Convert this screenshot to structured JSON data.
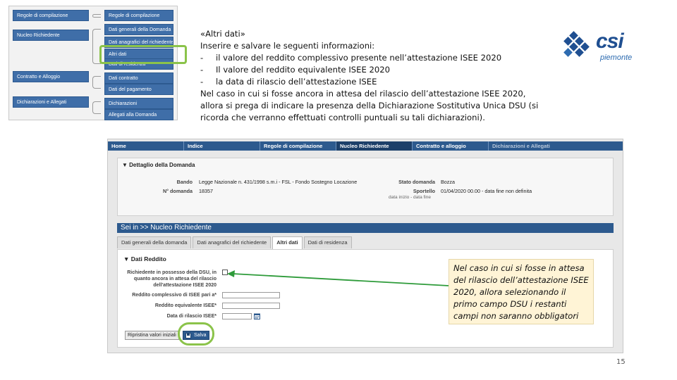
{
  "thumbnail": {
    "left_nodes": [
      "Regole di compilazione",
      "Nucleo Richiedente",
      "Contratto e Alloggio",
      "Dichiarazioni e Allegati"
    ],
    "right_nodes": [
      "Regole di compilazione",
      "Dati generali della Domanda",
      "Dati anagrafici del richiedente",
      "Altri dati",
      "Dati di residenza",
      "Dati contratto",
      "Dati del pagamento",
      "Dichiarazioni",
      "Allegati alla Domanda"
    ]
  },
  "info": {
    "title": "«Altri dati»",
    "intro": "Inserire e salvare le seguenti informazioni:",
    "bullets": [
      "il valore del reddito complessivo presente nell’attestazione ISEE 2020",
      "Il valore del reddito equivalente ISEE 2020",
      "la data di rilascio dell’attestazione ISEE"
    ],
    "bullet_marker": "-",
    "note": "Nel caso in cui si fosse ancora in attesa del rilascio dell’attestazione ISEE 2020, allora si prega di indicare la presenza della Dichiarazione Sostitutiva Unica DSU (si ricorda che verranno effettuati controlli puntuali su tali dichiarazioni)."
  },
  "logo": {
    "word": "csi",
    "sub": "piemonte",
    "colors": {
      "primary": "#1f4f91",
      "secondary": "#2d6bb0"
    }
  },
  "app": {
    "tabs": [
      "Home",
      "Indice",
      "Regole di compilazione",
      "Nucleo Richiedente",
      "Contratto e alloggio",
      "Dichiarazioni e Allegati"
    ],
    "detail": {
      "title": "▼ Dettaglio della Domanda",
      "bando_label": "Bando",
      "bando_value": "Legge Nazionale n. 431/1998 s.m.i - FSL - Fondo Sostegno Locazione",
      "numero_label": "N° domanda",
      "numero_value": "18357",
      "stato_label": "Stato domanda",
      "stato_value": "Bozza",
      "sportello_label": "Sportello",
      "sportello_value": "01/04/2020 00.00 - data fine non definita",
      "sportello_sub": "data inizio - data fine"
    },
    "section_title": "Sei in >> Nucleo Richiedente",
    "subtabs": [
      "Dati generali della domanda",
      "Dati anagrafici del richiedente",
      "Altri dati",
      "Dati di residenza"
    ],
    "form": {
      "title": "▼ Dati Reddito",
      "dsu_label": "Richiedente in possesso della DSU, in quanto ancora in attesa del rilascio dell'attestazione ISEE 2020",
      "reddito_complessivo_label": "Reddito complessivo di ISEE pari a*",
      "reddito_equivalente_label": "Reddito equivalente ISEE*",
      "data_rilascio_label": "Data di rilascio ISEE*",
      "reset_label": "Ripristina valori iniziali",
      "save_label": "Salva"
    }
  },
  "callout": "Nel caso in cui si fosse in attesa del rilascio dell’attestazione ISEE 2020, allora selezionando il primo campo DSU i restanti campi non saranno obbligatori",
  "page_number": "15",
  "colors": {
    "nav_blue": "#2d5a8e",
    "highlight_green": "#8bc34a",
    "callout_bg": "#fff4d6"
  }
}
